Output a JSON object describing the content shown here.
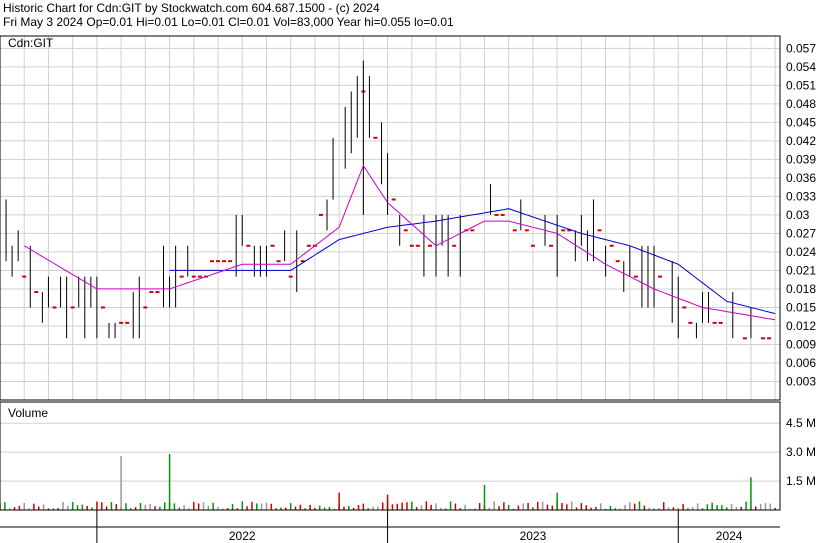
{
  "header": {
    "line1": "Historic Chart for Cdn:GIT by Stockwatch.com 604.687.1500 - (c) 2024",
    "line2": "Fri May  3 2024  Op=0.01  Hi=0.01  Lo=0.01  Cl=0.01  Vol=83,000  Year hi=0.055  lo=0.01"
  },
  "colors": {
    "price_up": "#000000",
    "price_down": "#cc0000",
    "ma_short": "#cc00cc",
    "ma_long": "#0000cc",
    "volume_up": "#009900",
    "volume_down": "#cc0000",
    "volume_neutral": "#999999",
    "grid": "#d0d0d0"
  },
  "chart_data": [
    {
      "type": "line",
      "subtype": "price-bars",
      "title": "Cdn:GIT",
      "ylim": [
        0,
        0.059
      ],
      "yticks": [
        "0.057",
        "0.054",
        "0.051",
        "0.048",
        "0.045",
        "0.042",
        "0.039",
        "0.036",
        "0.033",
        "0.03",
        "0.027",
        "0.024",
        "0.021",
        "0.018",
        "0.015",
        "0.012",
        "0.009",
        "0.006",
        "0.003"
      ],
      "x": [
        "2022",
        "2023",
        "2024"
      ],
      "grid": true,
      "series": [],
      "anchors": [
        [
          "2021-09",
          0.03
        ],
        [
          "2021-10",
          0.02
        ],
        [
          "2021-11",
          0.015
        ],
        [
          "2021-12",
          0.015
        ],
        [
          "2022-01",
          0.015
        ],
        [
          "2022-02",
          0.012
        ],
        [
          "2022-03",
          0.015
        ],
        [
          "2022-04",
          0.02
        ],
        [
          "2022-05",
          0.02
        ],
        [
          "2022-06",
          0.022
        ],
        [
          "2022-07",
          0.025
        ],
        [
          "2022-08",
          0.025
        ],
        [
          "2022-09",
          0.02
        ],
        [
          "2022-10",
          0.025
        ],
        [
          "2022-11",
          0.04
        ],
        [
          "2022-12",
          0.05
        ],
        [
          "2023-01",
          0.035
        ],
        [
          "2023-02",
          0.025
        ],
        [
          "2023-03",
          0.025
        ],
        [
          "2023-04",
          0.025
        ],
        [
          "2023-05",
          0.03
        ],
        [
          "2023-06",
          0.03
        ],
        [
          "2023-07",
          0.025
        ],
        [
          "2023-08",
          0.025
        ],
        [
          "2023-09",
          0.03
        ],
        [
          "2023-10",
          0.025
        ],
        [
          "2023-11",
          0.02
        ],
        [
          "2023-12",
          0.02
        ],
        [
          "2024-01",
          0.015
        ],
        [
          "2024-02",
          0.012
        ],
        [
          "2024-03",
          0.012
        ],
        [
          "2024-04",
          0.01
        ],
        [
          "2024-05",
          0.01
        ]
      ],
      "ma_short_pts": [
        [
          "2021-10",
          0.025
        ],
        [
          "2022-01",
          0.018
        ],
        [
          "2022-04",
          0.018
        ],
        [
          "2022-07",
          0.022
        ],
        [
          "2022-09",
          0.022
        ],
        [
          "2022-11",
          0.028
        ],
        [
          "2022-12",
          0.038
        ],
        [
          "2023-01",
          0.032
        ],
        [
          "2023-03",
          0.025
        ],
        [
          "2023-05",
          0.029
        ],
        [
          "2023-06",
          0.029
        ],
        [
          "2023-08",
          0.027
        ],
        [
          "2023-10",
          0.022
        ],
        [
          "2023-12",
          0.018
        ],
        [
          "2024-02",
          0.015
        ],
        [
          "2024-05",
          0.013
        ]
      ],
      "ma_long_pts": [
        [
          "2022-04",
          0.021
        ],
        [
          "2022-09",
          0.021
        ],
        [
          "2022-11",
          0.026
        ],
        [
          "2023-01",
          0.028
        ],
        [
          "2023-03",
          0.029
        ],
        [
          "2023-06",
          0.031
        ],
        [
          "2023-09",
          0.027
        ],
        [
          "2023-11",
          0.025
        ],
        [
          "2024-01",
          0.022
        ],
        [
          "2024-03",
          0.016
        ],
        [
          "2024-05",
          0.014
        ]
      ]
    },
    {
      "type": "bar",
      "title": "Volume",
      "ylim": [
        0,
        5600000
      ],
      "yticks": [
        "4.5 M",
        "3.0 M",
        "1.5 M"
      ],
      "spikes": [
        [
          "2022-02",
          2800000,
          "neutral"
        ],
        [
          "2022-04",
          2900000,
          "up"
        ],
        [
          "2024-04",
          1700000,
          "up"
        ],
        [
          "2023-05",
          1300000,
          "up"
        ],
        [
          "2022-11",
          900000,
          "down"
        ],
        [
          "2023-01",
          800000,
          "down"
        ],
        [
          "2023-08",
          900000,
          "up"
        ]
      ]
    }
  ]
}
